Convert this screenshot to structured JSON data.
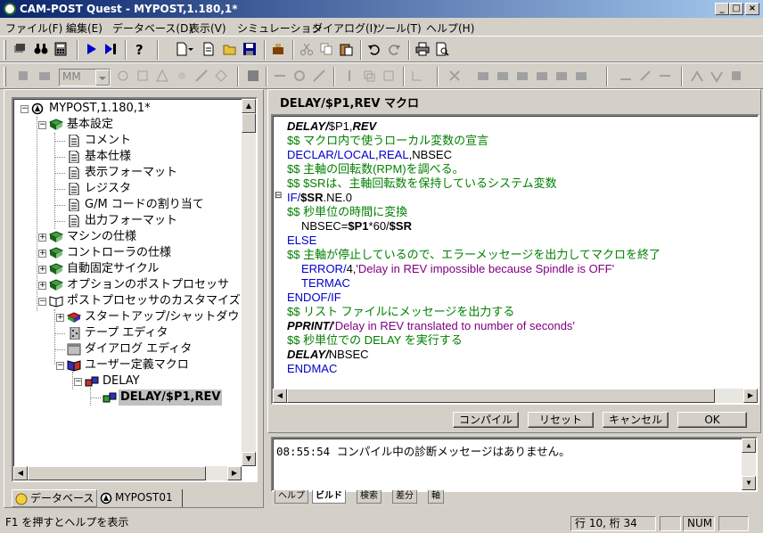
{
  "window": {
    "title": "CAM-POST Quest - MYPOST,1.180,1*",
    "minimize_label": "_",
    "maximize_label": "□",
    "close_label": "×"
  },
  "menu": [
    "ファイル(F)",
    "編集(E)",
    "データベース(D)",
    "表示(V)",
    "シミュレーション",
    "ダイアログ(I)",
    "ツール(T)",
    "ヘルプ(H)"
  ],
  "toolbar": {
    "mm_combo": "MM"
  },
  "tree": {
    "root": "MYPOST,1.180,1*",
    "basic_settings": "基本設定",
    "comment": "コメント",
    "basic_spec": "基本仕様",
    "display_format": "表示フォーマット",
    "register": "レジスタ",
    "gm_code": "G/M コードの割り当て",
    "output_format": "出力フォーマット",
    "machine_spec": "マシンの仕様",
    "controller_spec": "コントローラの仕様",
    "fixed_cycle": "自動固定サイクル",
    "option_post": "オプションのポストプロセッサ",
    "customize": "ポストプロセッサのカスタマイズ",
    "startup": "スタートアップ/シャットダウ",
    "tape_editor": "テープ エディタ",
    "dialog_editor": "ダイアログ エディタ",
    "user_macro": "ユーザー定義マクロ",
    "delay": "DELAY",
    "delay_macro": "DELAY/$P1,REV"
  },
  "left_tabs": {
    "database": "データベース",
    "mypost": "MYPOST01"
  },
  "editor": {
    "header": "DELAY/$P1,REV マクロ",
    "lines": [
      {
        "parts": [
          {
            "t": "DELAY/",
            "c": "black italic"
          },
          {
            "t": "$P1,",
            "c": "black"
          },
          {
            "t": "REV",
            "c": "black italic"
          }
        ]
      },
      {
        "parts": [
          {
            "t": "$$ マクロ内で使うローカル変数の宣言",
            "c": "green"
          }
        ]
      },
      {
        "parts": [
          {
            "t": "DECLAR/LOCAL",
            "c": "blue"
          },
          {
            "t": ",",
            "c": "black"
          },
          {
            "t": "REAL",
            "c": "blue"
          },
          {
            "t": ",NBSEC",
            "c": "black"
          }
        ]
      },
      {
        "parts": [
          {
            "t": "$$ 主軸の回転数(RPM)を調べる。",
            "c": "green"
          }
        ]
      },
      {
        "parts": [
          {
            "t": "$$ $SRは、主軸回転数を保持しているシステム変数",
            "c": "green"
          }
        ]
      },
      {
        "parts": [
          {
            "t": "IF/",
            "c": "blue"
          },
          {
            "t": "$SR",
            "c": "black bold"
          },
          {
            "t": ".NE.0",
            "c": "black"
          }
        ]
      },
      {
        "parts": [
          {
            "t": "$$ 秒単位の時間に変換",
            "c": "green"
          }
        ]
      },
      {
        "parts": [
          {
            "t": "NBSEC=",
            "c": "black"
          },
          {
            "t": "$P1",
            "c": "black bold"
          },
          {
            "t": "*60/",
            "c": "black"
          },
          {
            "t": "$SR",
            "c": "black bold"
          }
        ]
      },
      {
        "parts": [
          {
            "t": "ELSE",
            "c": "blue"
          }
        ]
      },
      {
        "parts": [
          {
            "t": "$$ 主軸が停止しているので、エラーメッセージを出力してマクロを終了",
            "c": "green"
          }
        ]
      },
      {
        "parts": [
          {
            "t": "ERROR/",
            "c": "blue"
          },
          {
            "t": "4,",
            "c": "black"
          },
          {
            "t": "'Delay in REV impossible because Spindle is OFF'",
            "c": "purple"
          }
        ]
      },
      {
        "parts": [
          {
            "t": "TERMAC",
            "c": "blue"
          }
        ]
      },
      {
        "parts": [
          {
            "t": "ENDOF/IF",
            "c": "blue"
          }
        ]
      },
      {
        "parts": [
          {
            "t": "$$ リスト ファイルにメッセージを出力する",
            "c": "green"
          }
        ]
      },
      {
        "parts": [
          {
            "t": "PPRINT/",
            "c": "black italic"
          },
          {
            "t": "'Delay in REV translated to number of seconds'",
            "c": "purple"
          }
        ]
      },
      {
        "parts": [
          {
            "t": "$$ 秒単位での DELAY を実行する",
            "c": "green"
          }
        ]
      },
      {
        "parts": [
          {
            "t": "DELAY/",
            "c": "black italic"
          },
          {
            "t": "NBSEC",
            "c": "black"
          }
        ]
      },
      {
        "parts": [
          {
            "t": "ENDMAC",
            "c": "blue"
          }
        ]
      }
    ]
  },
  "buttons": {
    "compile": "コンパイル",
    "reset": "リセット",
    "cancel": "キャンセル",
    "ok": "OK"
  },
  "output": {
    "message": "08:55:54 コンパイル中の診断メッセージはありません。"
  },
  "output_tabs": [
    "ヘルプ",
    "ビルド",
    "検索",
    "差分",
    "軸"
  ],
  "status": {
    "help": "F1 を押すとヘルプを表示",
    "position": "行 10, 桁 34",
    "num": "NUM"
  }
}
